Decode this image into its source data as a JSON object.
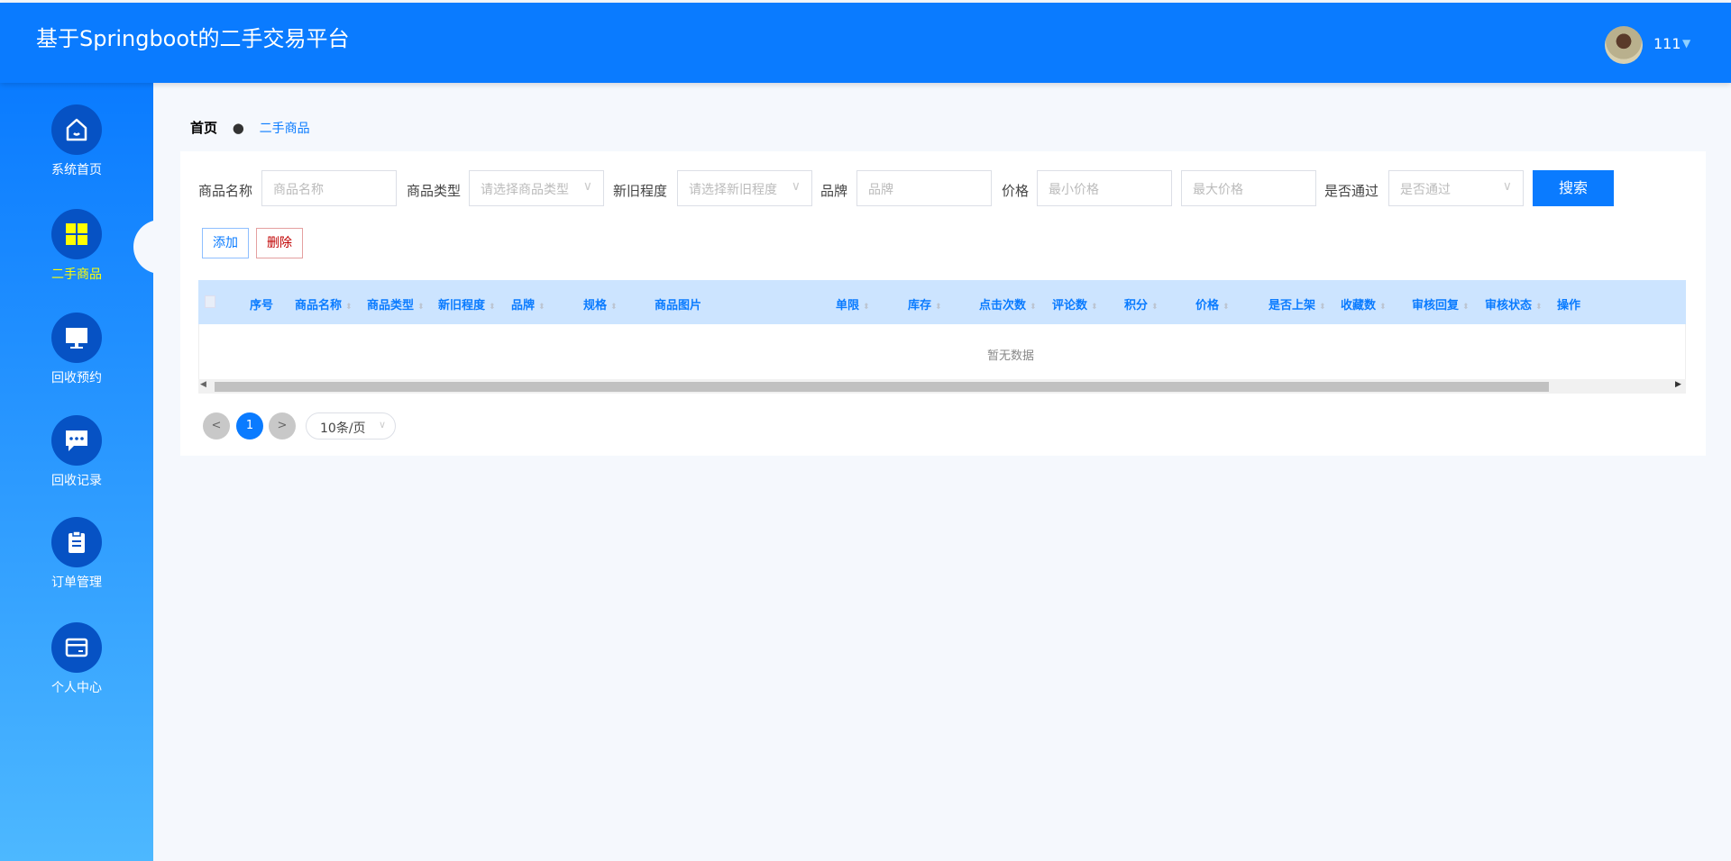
{
  "header": {
    "title": "基于Springboot的二手交易平台",
    "username": "111"
  },
  "sidebar": {
    "items": [
      {
        "label": "系统首页",
        "icon": "home-icon"
      },
      {
        "label": "二手商品",
        "icon": "grid-icon",
        "active": true
      },
      {
        "label": "回收预约",
        "icon": "monitor-icon"
      },
      {
        "label": "回收记录",
        "icon": "chat-icon"
      },
      {
        "label": "订单管理",
        "icon": "clipboard-icon"
      },
      {
        "label": "个人中心",
        "icon": "card-icon"
      }
    ]
  },
  "breadcrumb": {
    "home": "首页",
    "current": "二手商品"
  },
  "filters": {
    "name_label": "商品名称",
    "name_placeholder": "商品名称",
    "type_label": "商品类型",
    "type_placeholder": "请选择商品类型",
    "condition_label": "新旧程度",
    "condition_placeholder": "请选择新旧程度",
    "brand_label": "品牌",
    "brand_placeholder": "品牌",
    "price_label": "价格",
    "min_price_placeholder": "最小价格",
    "max_price_placeholder": "最大价格",
    "approved_label": "是否通过",
    "approved_placeholder": "是否通过",
    "search": "搜索"
  },
  "actions": {
    "add": "添加",
    "delete": "删除"
  },
  "table": {
    "columns": [
      "序号",
      "商品名称",
      "商品类型",
      "新旧程度",
      "品牌",
      "规格",
      "商品图片",
      "单限",
      "库存",
      "点击次数",
      "评论数",
      "积分",
      "价格",
      "是否上架",
      "收藏数",
      "审核回复",
      "审核状态",
      "操作"
    ],
    "empty": "暂无数据"
  },
  "pagination": {
    "prev": "<",
    "current": "1",
    "next": ">",
    "page_size": "10条/页"
  },
  "colors": {
    "primary": "#0a7bff",
    "active_nav": "#ffff00",
    "danger": "#c00000"
  }
}
